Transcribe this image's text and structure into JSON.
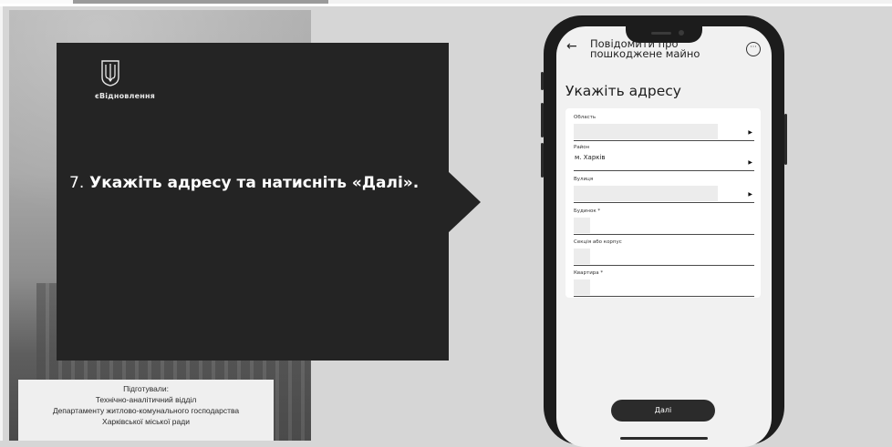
{
  "brand": {
    "logo_text": "єВідновлення"
  },
  "callout": {
    "step_number": "7.",
    "text": "Укажіть адресу та натисніть «Далі»."
  },
  "credits": {
    "lines": [
      "Підготували:",
      "Технічно-аналітичний відділ",
      "Департаменту житлово-комунального господарства",
      "Харківської міської ради"
    ]
  },
  "phone": {
    "nav_title_line1": "Повідомити про",
    "nav_title_line2": "пошкоджене майно",
    "back_icon": "arrow-left-icon",
    "menu_icon": "more-horizontal-icon",
    "page_heading": "Укажіть адресу",
    "fields": [
      {
        "label": "Область",
        "value": "",
        "dropdown": true
      },
      {
        "label": "Район",
        "value": "м. Харків",
        "dropdown": true
      },
      {
        "label": "Вулиця",
        "value": "",
        "dropdown": true
      },
      {
        "label": "Будинок *",
        "value": "",
        "dropdown": false
      },
      {
        "label": "Секція або корпус",
        "value": "",
        "dropdown": false
      },
      {
        "label": "Квартира *",
        "value": "",
        "dropdown": false
      }
    ],
    "next_label": "Далі"
  },
  "colors": {
    "callout_bg": "#242424",
    "phone_body": "#1c1c1c",
    "screen_bg": "#f1f1f1"
  }
}
